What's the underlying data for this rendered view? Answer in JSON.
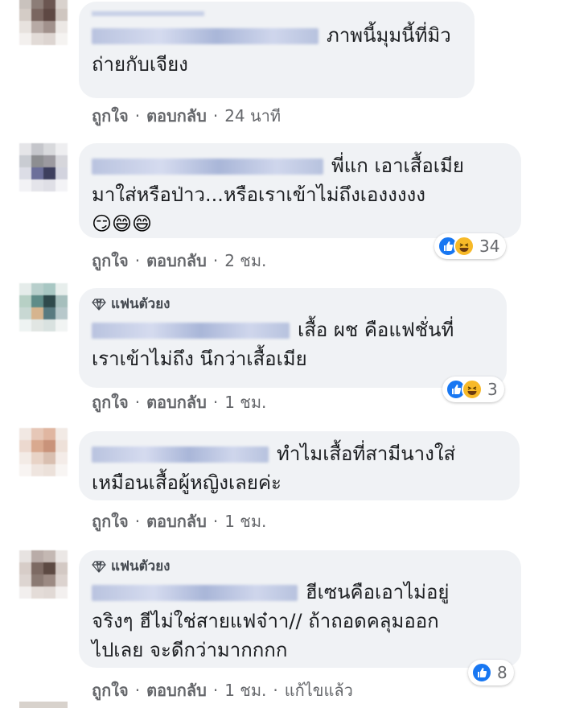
{
  "comments": [
    {
      "badge": "",
      "text_line1": "ภาพนี้มุมนี้ที่มิว",
      "text_rest": "ถ่ายกับเจียง",
      "emojis": "",
      "actions": {
        "like": "ถูกใจ",
        "reply": "ตอบกลับ",
        "time": "24 นาที",
        "edited": ""
      },
      "reaction_count": ""
    },
    {
      "badge": "",
      "text_line1": "พี่แก เอาเสื้อเมีย",
      "text_rest": "มาใส่หรือป่าว...หรือเราเข้าไม่ถึงเองงงงง",
      "emojis": "😏😄😄",
      "actions": {
        "like": "ถูกใจ",
        "reply": "ตอบกลับ",
        "time": "2 ชม.",
        "edited": ""
      },
      "reaction_count": "34"
    },
    {
      "badge": "แฟนตัวยง",
      "text_line1": "เสื้อ ผช คือแฟชั่นที่",
      "text_rest": "เราเข้าไม่ถึง นึกว่าเสื้อเมีย",
      "emojis": "",
      "actions": {
        "like": "ถูกใจ",
        "reply": "ตอบกลับ",
        "time": "1 ชม.",
        "edited": ""
      },
      "reaction_count": "3"
    },
    {
      "badge": "",
      "text_line1": "ทำไมเสื้อที่สามีนางใส่",
      "text_rest": "เหมือนเสื้อผู้หญิงเลยค่ะ",
      "emojis": "",
      "actions": {
        "like": "ถูกใจ",
        "reply": "ตอบกลับ",
        "time": "1 ชม.",
        "edited": ""
      },
      "reaction_count": ""
    },
    {
      "badge": "แฟนตัวยง",
      "text_line1": "ฮีเซนคือเอาไม่อยู่",
      "text_rest": "จริงๆ ฮีไม่ใช่สายแฟจ๋าา// ถ้าถอดคลุมออก\nไปเลย จะดีกว่ามากกกก",
      "emojis": "",
      "actions": {
        "like": "ถูกใจ",
        "reply": "ตอบกลับ",
        "time": "1 ชม.",
        "edited": "แก้ไขแล้ว"
      },
      "reaction_count": "8"
    }
  ],
  "separator": "·",
  "colors": {
    "bubble": "#f0f2f5",
    "meta": "#65676b",
    "like_blue": "#1877f2",
    "haha_yellow": "#f7b928"
  },
  "icons": {
    "badge": "diamond-icon",
    "like": "like-icon",
    "haha": "haha-icon"
  }
}
